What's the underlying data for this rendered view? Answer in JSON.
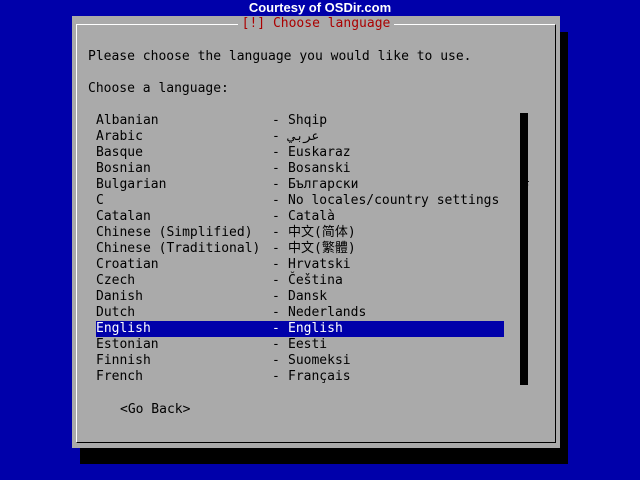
{
  "watermark": "Courtesy of OSDir.com",
  "dialog": {
    "title": "[!] Choose language",
    "instruction": "Please choose the language you would like to use.",
    "prompt": "Choose a language:",
    "back_button": "<Go Back>",
    "scroll_marker": "#"
  },
  "languages": [
    {
      "name": "Albanian",
      "native": "Shqip"
    },
    {
      "name": "Arabic",
      "native": "عربي"
    },
    {
      "name": "Basque",
      "native": "Euskaraz"
    },
    {
      "name": "Bosnian",
      "native": "Bosanski"
    },
    {
      "name": "Bulgarian",
      "native": "Български"
    },
    {
      "name": "C",
      "native": "No locales/country settings"
    },
    {
      "name": "Catalan",
      "native": "Català"
    },
    {
      "name": "Chinese (Simplified)",
      "native": "中文(简体)"
    },
    {
      "name": "Chinese (Traditional)",
      "native": "中文(繁體)"
    },
    {
      "name": "Croatian",
      "native": "Hrvatski"
    },
    {
      "name": "Czech",
      "native": "Čeština"
    },
    {
      "name": "Danish",
      "native": "Dansk"
    },
    {
      "name": "Dutch",
      "native": "Nederlands"
    },
    {
      "name": "English",
      "native": "English"
    },
    {
      "name": "Estonian",
      "native": "Eesti"
    },
    {
      "name": "Finnish",
      "native": "Suomeksi"
    },
    {
      "name": "French",
      "native": "Français"
    }
  ],
  "selected_index": 13,
  "separator": "-",
  "colors": {
    "background": "#0000aa",
    "dialog": "#aaaaaa",
    "title": "#aa0000",
    "selection": "#0000aa"
  }
}
